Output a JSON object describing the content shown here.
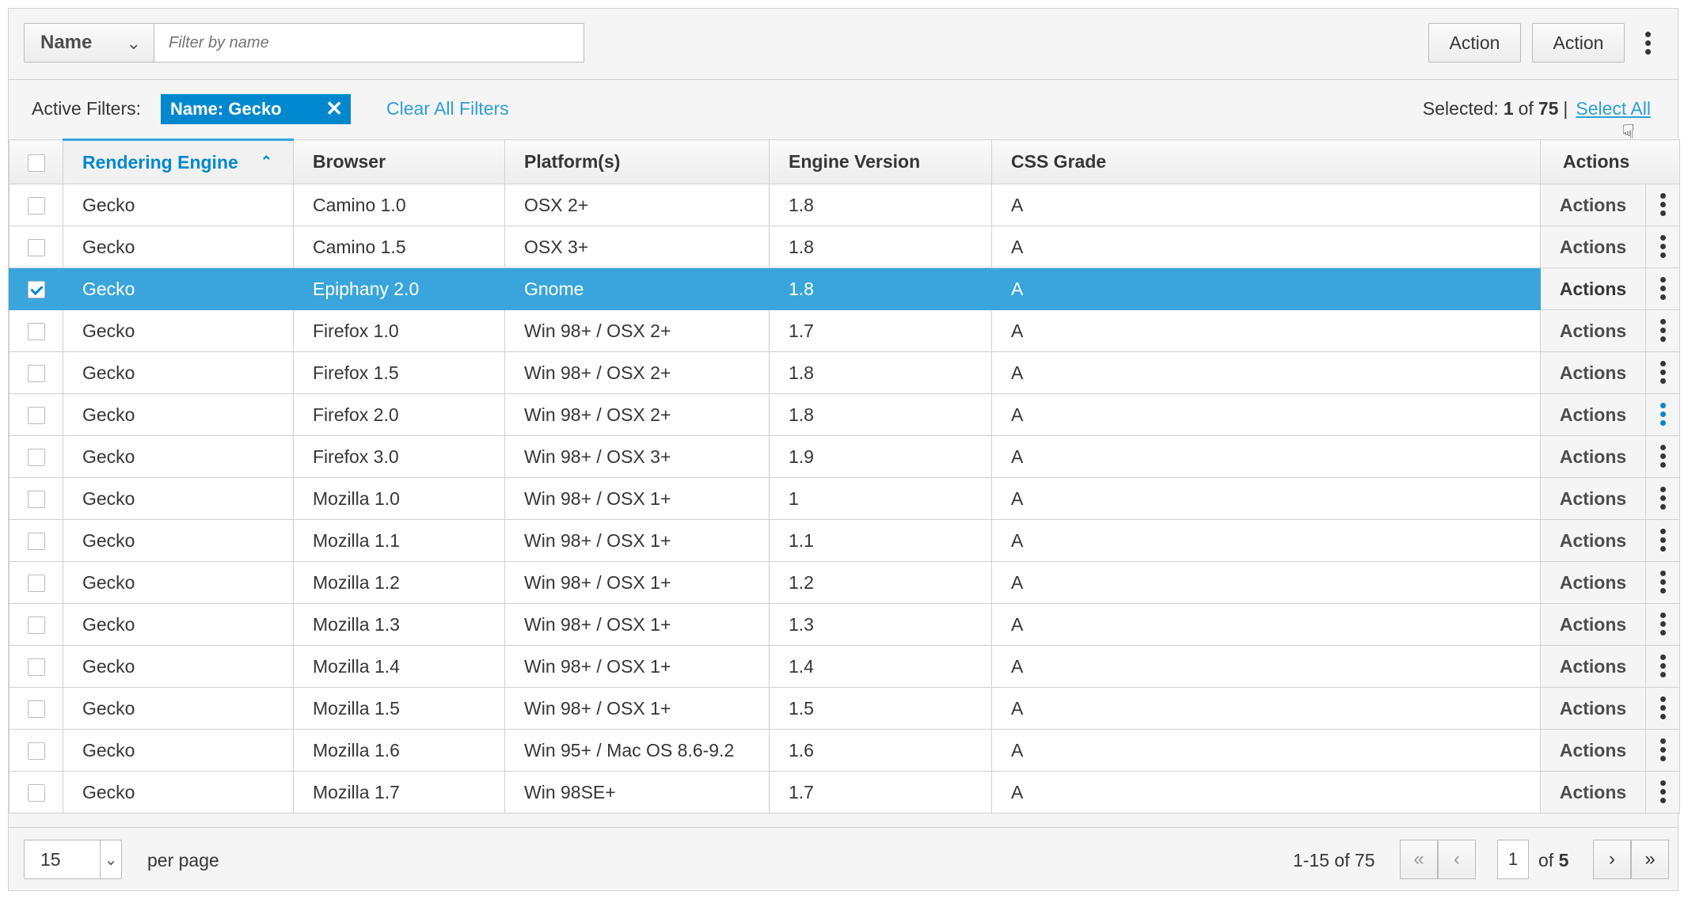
{
  "toolbar": {
    "filter_field": "Name",
    "filter_placeholder": "Filter by name",
    "action1": "Action",
    "action2": "Action"
  },
  "filters": {
    "label": "Active Filters:",
    "chip": "Name: Gecko",
    "clear": "Clear All Filters",
    "selected_label": "Selected:",
    "selected_count": "1",
    "selected_of": "of",
    "selected_total": "75",
    "separator": "|",
    "select_all": "Select All"
  },
  "table": {
    "columns": [
      "Rendering Engine",
      "Browser",
      "Platform(s)",
      "Engine Version",
      "CSS Grade",
      "Actions"
    ],
    "action_label": "Actions",
    "rows": [
      {
        "engine": "Gecko",
        "browser": "Camino 1.0",
        "platform": "OSX 2+",
        "version": "1.8",
        "grade": "A",
        "checked": false
      },
      {
        "engine": "Gecko",
        "browser": "Camino 1.5",
        "platform": "OSX 3+",
        "version": "1.8",
        "grade": "A",
        "checked": false
      },
      {
        "engine": "Gecko",
        "browser": "Epiphany 2.0",
        "platform": "Gnome",
        "version": "1.8",
        "grade": "A",
        "checked": true
      },
      {
        "engine": "Gecko",
        "browser": "Firefox 1.0",
        "platform": "Win 98+ / OSX 2+",
        "version": "1.7",
        "grade": "A",
        "checked": false
      },
      {
        "engine": "Gecko",
        "browser": "Firefox 1.5",
        "platform": "Win 98+ / OSX 2+",
        "version": "1.8",
        "grade": "A",
        "checked": false
      },
      {
        "engine": "Gecko",
        "browser": "Firefox 2.0",
        "platform": "Win 98+ / OSX 2+",
        "version": "1.8",
        "grade": "A",
        "checked": false
      },
      {
        "engine": "Gecko",
        "browser": "Firefox 3.0",
        "platform": "Win 98+ / OSX 3+",
        "version": "1.9",
        "grade": "A",
        "checked": false
      },
      {
        "engine": "Gecko",
        "browser": "Mozilla 1.0",
        "platform": "Win 98+ / OSX 1+",
        "version": "1",
        "grade": "A",
        "checked": false
      },
      {
        "engine": "Gecko",
        "browser": "Mozilla 1.1",
        "platform": "Win 98+ / OSX 1+",
        "version": "1.1",
        "grade": "A",
        "checked": false
      },
      {
        "engine": "Gecko",
        "browser": "Mozilla 1.2",
        "platform": "Win 98+ / OSX 1+",
        "version": "1.2",
        "grade": "A",
        "checked": false
      },
      {
        "engine": "Gecko",
        "browser": "Mozilla 1.3",
        "platform": "Win 98+ / OSX 1+",
        "version": "1.3",
        "grade": "A",
        "checked": false
      },
      {
        "engine": "Gecko",
        "browser": "Mozilla 1.4",
        "platform": "Win 98+ / OSX 1+",
        "version": "1.4",
        "grade": "A",
        "checked": false
      },
      {
        "engine": "Gecko",
        "browser": "Mozilla 1.5",
        "platform": "Win 98+ / OSX 1+",
        "version": "1.5",
        "grade": "A",
        "checked": false
      },
      {
        "engine": "Gecko",
        "browser": "Mozilla 1.6",
        "platform": "Win 95+ / Mac OS 8.6-9.2",
        "version": "1.6",
        "grade": "A",
        "checked": false
      },
      {
        "engine": "Gecko",
        "browser": "Mozilla 1.7",
        "platform": "Win 98SE+",
        "version": "1.7",
        "grade": "A",
        "checked": false
      }
    ]
  },
  "pagination": {
    "per_page": "15",
    "per_page_label": "per page",
    "range": "1-15 of 75",
    "current_page": "1",
    "of_label": "of",
    "total_pages": "5"
  },
  "colors": {
    "accent": "#0088ce",
    "selected_row": "#39a5dc",
    "link": "#2d9fd9"
  }
}
